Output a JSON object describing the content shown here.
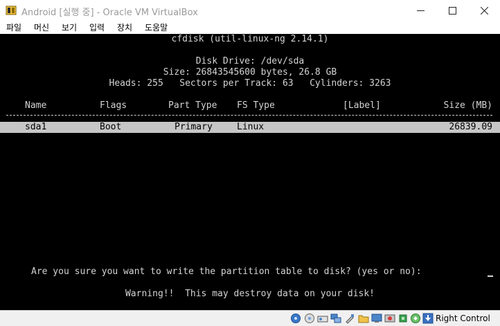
{
  "window": {
    "title": "Android [실행 중] - Oracle VM VirtualBox"
  },
  "menu": [
    "파일",
    "머신",
    "보기",
    "입력",
    "장치",
    "도움말"
  ],
  "terminal": {
    "header": "cfdisk (util-linux-ng 2.14.1)",
    "disk_drive": "Disk Drive: /dev/sda",
    "size_line": "Size: 26843545600 bytes, 26.8 GB",
    "geometry_line": "Heads: 255   Sectors per Track: 63   Cylinders: 3263",
    "columns": {
      "name": "Name",
      "flags": "Flags",
      "part_type": "Part Type",
      "fs_type": "FS Type",
      "label": "[Label]",
      "size": "Size (MB)"
    },
    "rows": [
      {
        "name": "sda1",
        "flags": "Boot",
        "part_type": "Primary",
        "fs_type": "Linux",
        "label": "",
        "size": "26839.09"
      }
    ],
    "prompt": "Are you sure you want to write the partition table to disk? (yes or no):",
    "warning": "Warning!!  This may destroy data on your disk!"
  },
  "statusbar": {
    "host_key": "Right Control",
    "icons": [
      "hard-disk-icon",
      "optical-drive-icon",
      "audio-icon",
      "network-icon",
      "usb-icon",
      "shared-folder-icon",
      "display-icon",
      "video-capture-icon",
      "cpu-icon",
      "mouse-integration-icon",
      "host-key-arrow-icon"
    ]
  },
  "colors": {
    "screen_bg": "#000000",
    "terminal_text": "#d4d4d4",
    "selection_bg": "#c6c6c6",
    "title_text": "#9a9a9a"
  }
}
